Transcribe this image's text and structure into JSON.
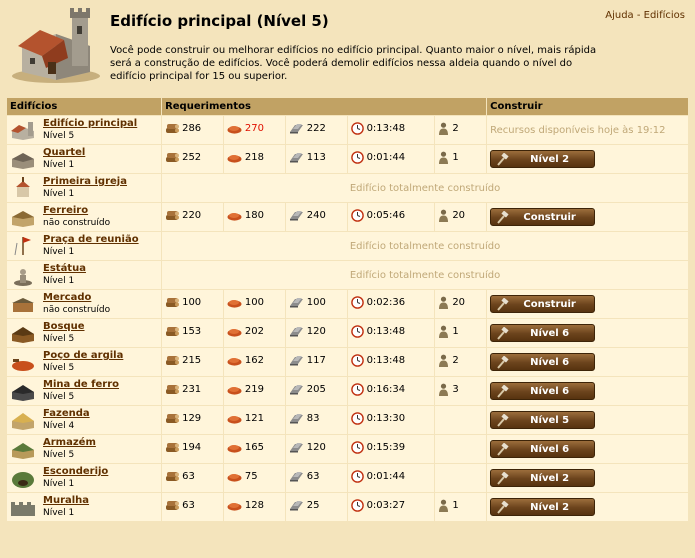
{
  "header": {
    "title": "Edifício principal (Nível 5)",
    "description": "Você pode construir ou melhorar edifícios no edifício principal. Quanto maior o nível, mais rápida será a construção de edifícios. Você poderá demolir edifícios nessa aldeia quando o nível do edifício principal for 15 ou superior.",
    "links": {
      "help": "Ajuda",
      "sep": " - ",
      "buildings": "Edifícios"
    }
  },
  "columns": {
    "buildings": "Edifícios",
    "requirements": "Requerimentos",
    "build": "Construir"
  },
  "complete_text": "Edifício totalmente construído",
  "rows": [
    {
      "name": "Edifício principal",
      "level": "Nível 5",
      "wood": "286",
      "clay": "270",
      "clay_red": true,
      "iron": "222",
      "time": "0:13:48",
      "pop": "2",
      "action": "",
      "avail": "Recursos disponíveis hoje às 19:12",
      "icon": "main-building-icon"
    },
    {
      "name": "Quartel",
      "level": "Nível 1",
      "wood": "252",
      "clay": "218",
      "iron": "113",
      "time": "0:01:44",
      "pop": "1",
      "action": "Nível 2",
      "icon": "barracks-icon"
    },
    {
      "name": "Primeira igreja",
      "level": "Nível 1",
      "complete": true,
      "icon": "church-icon"
    },
    {
      "name": "Ferreiro",
      "level": "não construído",
      "wood": "220",
      "clay": "180",
      "iron": "240",
      "time": "0:05:46",
      "pop": "20",
      "action": "Construir",
      "icon": "smithy-icon"
    },
    {
      "name": "Praça de reunião",
      "level": "Nível 1",
      "complete": true,
      "icon": "rally-point-icon"
    },
    {
      "name": "Estátua",
      "level": "Nível 1",
      "complete": true,
      "icon": "statue-icon"
    },
    {
      "name": "Mercado",
      "level": "não construído",
      "wood": "100",
      "clay": "100",
      "iron": "100",
      "time": "0:02:36",
      "pop": "20",
      "action": "Construir",
      "icon": "market-icon"
    },
    {
      "name": "Bosque",
      "level": "Nível 5",
      "wood": "153",
      "clay": "202",
      "iron": "120",
      "time": "0:13:48",
      "pop": "1",
      "action": "Nível 6",
      "icon": "timber-camp-icon"
    },
    {
      "name": "Poço de argila",
      "level": "Nível 5",
      "wood": "215",
      "clay": "162",
      "iron": "117",
      "time": "0:13:48",
      "pop": "2",
      "action": "Nível 6",
      "icon": "clay-pit-icon"
    },
    {
      "name": "Mina de ferro",
      "level": "Nível 5",
      "wood": "231",
      "clay": "219",
      "iron": "205",
      "time": "0:16:34",
      "pop": "3",
      "action": "Nível 6",
      "icon": "iron-mine-icon"
    },
    {
      "name": "Fazenda",
      "level": "Nível 4",
      "wood": "129",
      "clay": "121",
      "iron": "83",
      "time": "0:13:30",
      "pop": "",
      "action": "Nível 5",
      "icon": "farm-icon"
    },
    {
      "name": "Armazém",
      "level": "Nível 5",
      "wood": "194",
      "clay": "165",
      "iron": "120",
      "time": "0:15:39",
      "pop": "",
      "action": "Nível 6",
      "icon": "warehouse-icon"
    },
    {
      "name": "Esconderijo",
      "level": "Nível 1",
      "wood": "63",
      "clay": "75",
      "iron": "63",
      "time": "0:01:44",
      "pop": "",
      "action": "Nível 2",
      "icon": "hiding-place-icon"
    },
    {
      "name": "Muralha",
      "level": "Nível 1",
      "wood": "63",
      "clay": "128",
      "iron": "25",
      "time": "0:03:27",
      "pop": "1",
      "action": "Nível 2",
      "icon": "wall-icon"
    }
  ],
  "colors": {
    "background": "#f4e4bc",
    "header": "#c1a264",
    "row": "#fff5da",
    "button": "#6b431c",
    "link": "#603000"
  }
}
